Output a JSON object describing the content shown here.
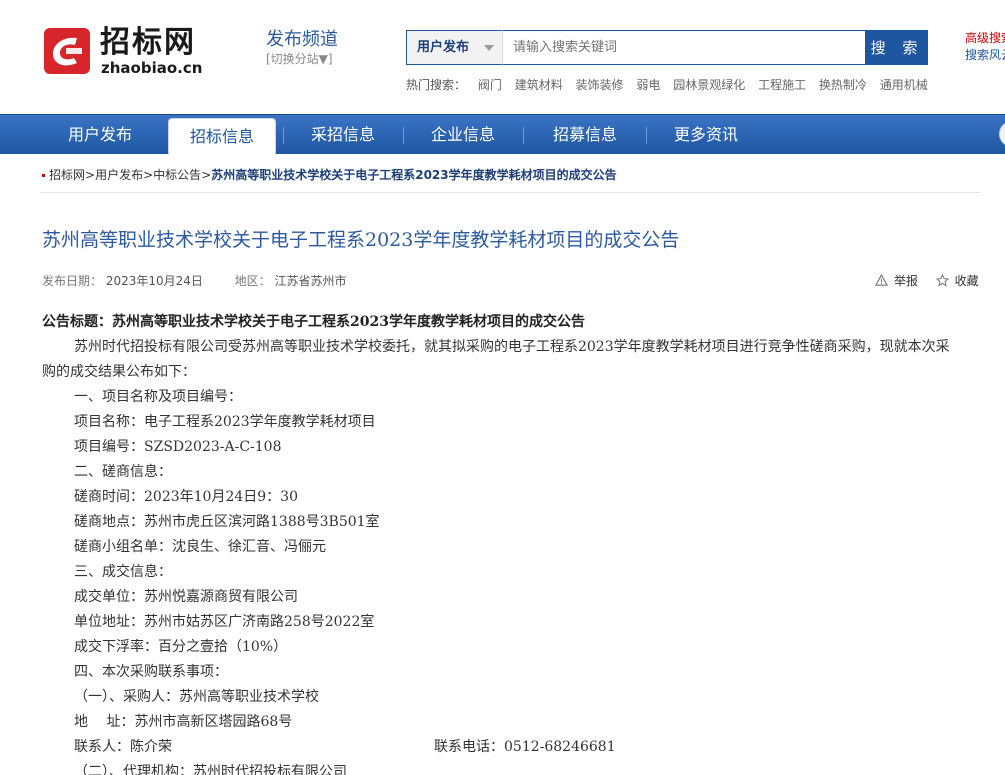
{
  "header": {
    "logo_cn": "招标网",
    "logo_en": "zhaobiao.cn",
    "channel_title": "发布频道",
    "channel_switch": "[切换分站▼]",
    "search_type": "用户发布",
    "search_placeholder": "请输入搜索关键词",
    "search_button": "搜 索",
    "adv_search": "高级搜索",
    "search_style": "搜索风云",
    "hot_label": "热门搜索：",
    "hot_items": [
      "阀门",
      "建筑材料",
      "装饰装修",
      "弱电",
      "园林景观绿化",
      "工程施工",
      "换热制冷",
      "通用机械"
    ]
  },
  "nav": {
    "items": [
      "用户发布",
      "招标信息",
      "采招信息",
      "企业信息",
      "招募信息",
      "更多资讯"
    ],
    "active_index": 1
  },
  "breadcrumb": {
    "items": [
      "招标网",
      "用户发布",
      "中标公告"
    ],
    "current": "苏州高等职业技术学校关于电子工程系2023学年度教学耗材项目的成交公告",
    "sep": ">"
  },
  "article": {
    "title": "苏州高等职业技术学校关于电子工程系2023学年度教学耗材项目的成交公告",
    "date_label": "发布日期：",
    "date": "2023年10月24日",
    "region_label": "地区：",
    "region": "江苏省苏州市",
    "report": "举报",
    "favorite": "收藏",
    "ann_title": "公告标题：苏州高等职业技术学校关于电子工程系2023学年度教学耗材项目的成交公告",
    "intro": "苏州时代招投标有限公司受苏州高等职业技术学校委托，就其拟采购的电子工程系2023学年度教学耗材项目进行竞争性磋商采购，现就本次采购的成交结果公布如下：",
    "lines": [
      "一、项目名称及项目编号：",
      "项目名称：电子工程系2023学年度教学耗材项目",
      "项目编号：SZSD2023-A-C-108",
      "二、磋商信息：",
      "磋商时间：2023年10月24日9：30",
      "磋商地点：苏州市虎丘区滨河路1388号3B501室",
      "磋商小组名单：沈良生、徐汇音、冯俪元",
      "三、成交信息：",
      "成交单位：苏州悦嘉源商贸有限公司",
      "单位地址：苏州市姑苏区广济南路258号2022室",
      "成交下浮率：百分之壹拾（10%）",
      "四、本次采购联系事项：",
      "（一）、采购人：苏州高等职业技术学校",
      "地　 址：苏州市高新区塔园路68号"
    ],
    "contact_left": "联系人：陈介荣",
    "contact_right": "联系电话：0512-68246681",
    "last_line": "（二）、代理机构：苏州时代招投标有限公司"
  },
  "colors": {
    "brand_blue": "#1e56a0",
    "title_blue": "#2c5a9e",
    "logo_red": "#d7252c"
  }
}
